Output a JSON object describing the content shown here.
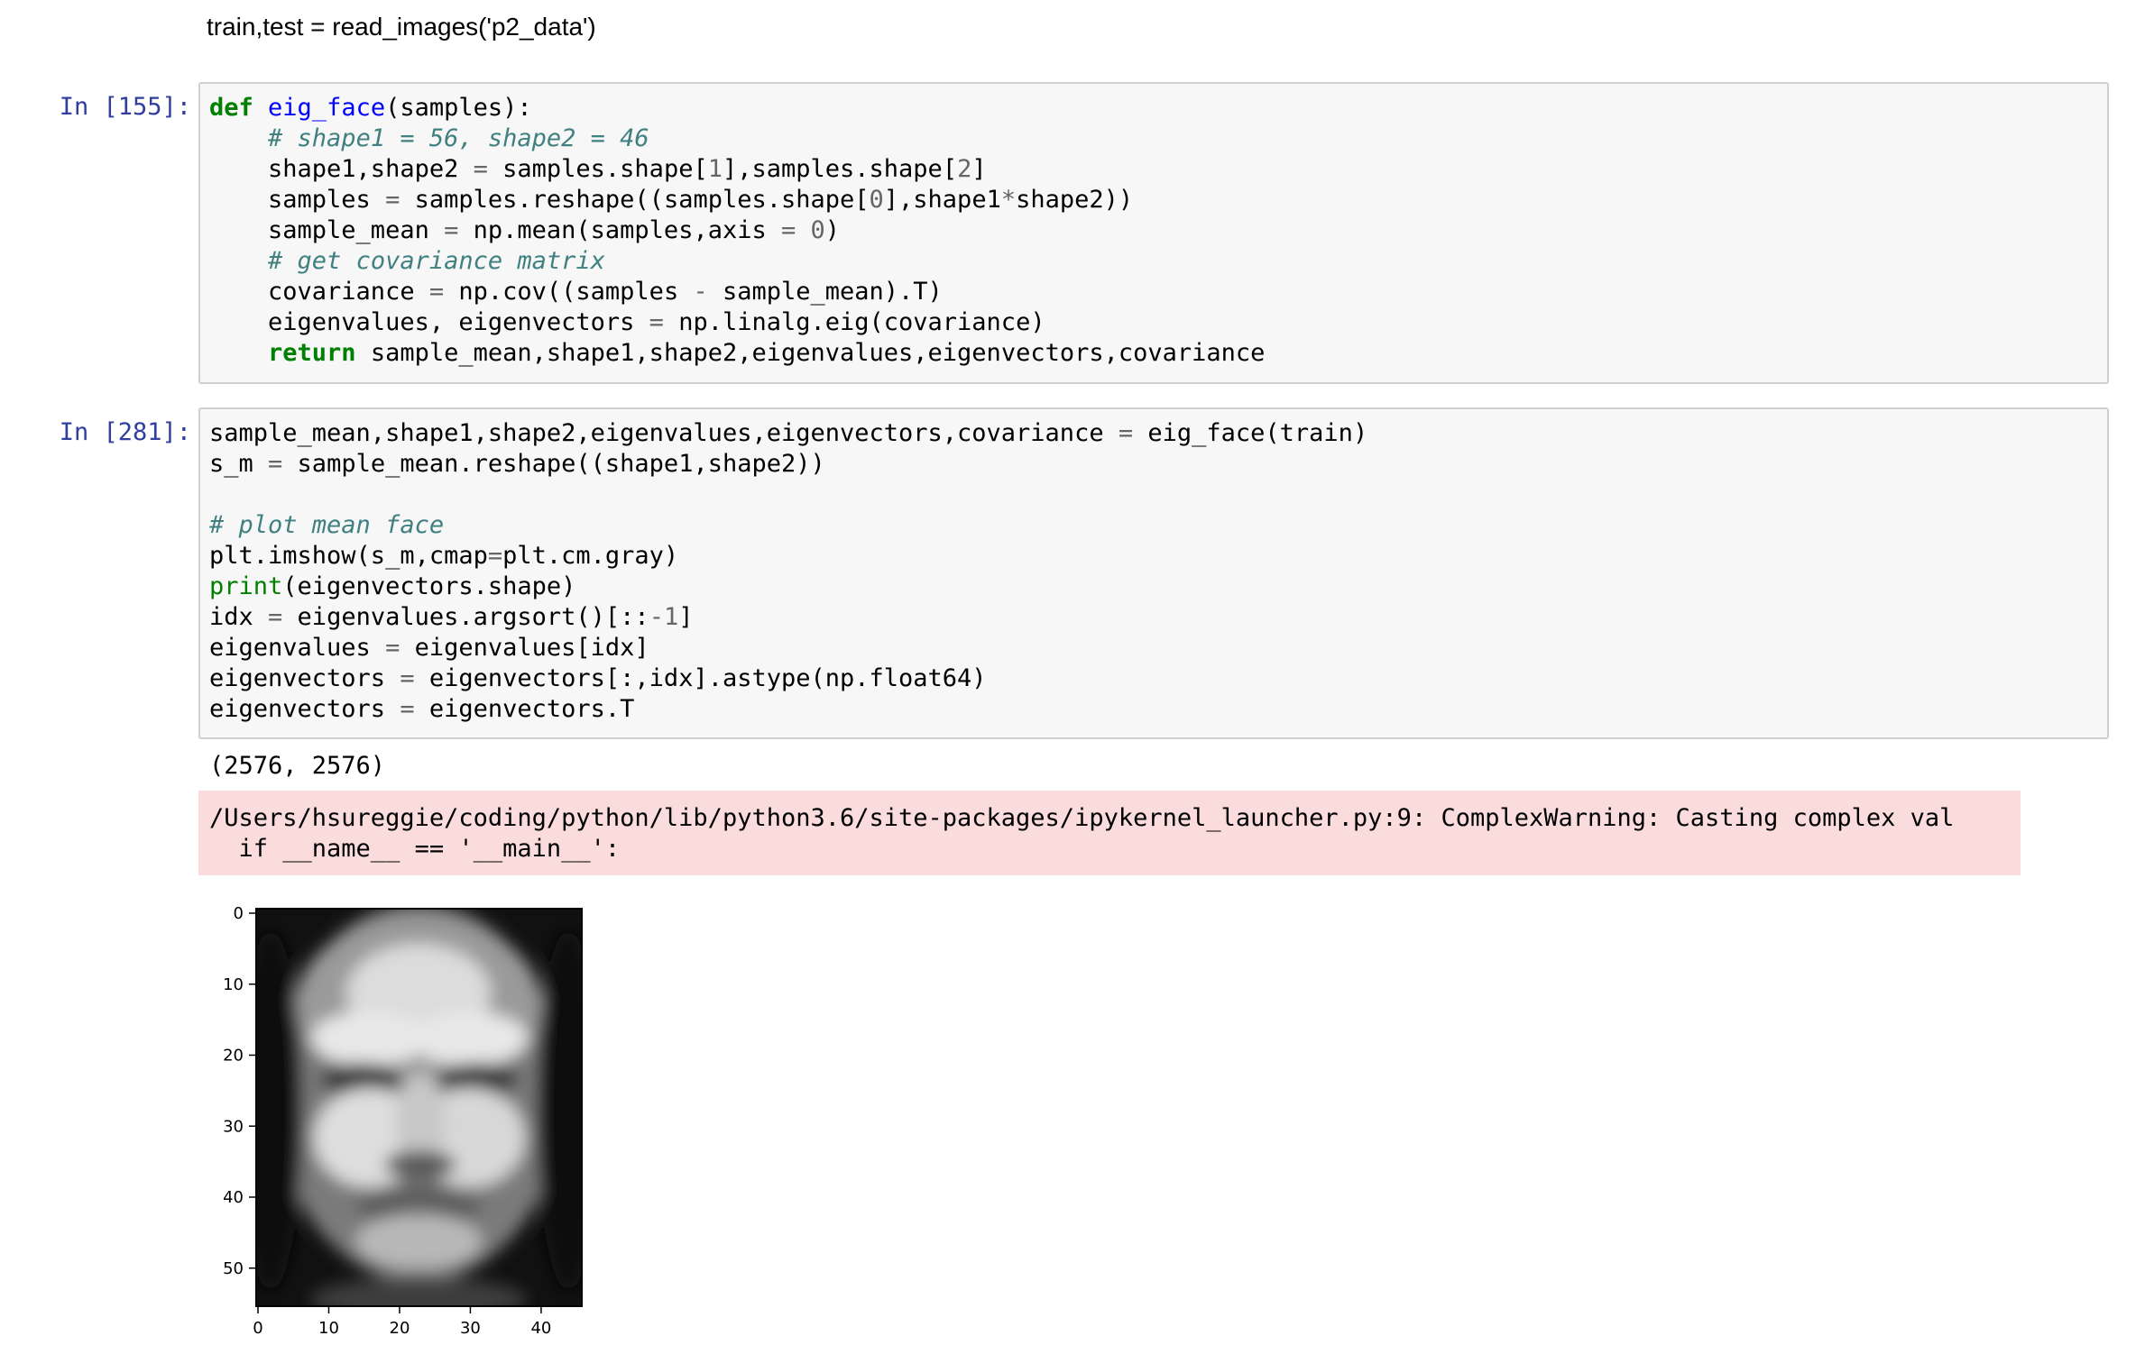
{
  "top_line": "train,test = read_images('p2_data')",
  "cells": [
    {
      "prompt": "In [155]:",
      "lines": [
        [
          [
            "kw",
            "def"
          ],
          [
            "t",
            " "
          ],
          [
            "fn",
            "eig_face"
          ],
          [
            "t",
            "(samples):"
          ]
        ],
        [
          [
            "t",
            "    "
          ],
          [
            "cm",
            "# shape1 = 56, shape2 = 46"
          ]
        ],
        [
          [
            "t",
            "    shape1,shape2 "
          ],
          [
            "op",
            "="
          ],
          [
            "t",
            " samples.shape["
          ],
          [
            "num",
            "1"
          ],
          [
            "t",
            "],samples.shape["
          ],
          [
            "num",
            "2"
          ],
          [
            "t",
            "]"
          ]
        ],
        [
          [
            "t",
            "    samples "
          ],
          [
            "op",
            "="
          ],
          [
            "t",
            " samples.reshape((samples.shape["
          ],
          [
            "num",
            "0"
          ],
          [
            "t",
            "],shape1"
          ],
          [
            "op",
            "*"
          ],
          [
            "t",
            "shape2))"
          ]
        ],
        [
          [
            "t",
            "    sample_mean "
          ],
          [
            "op",
            "="
          ],
          [
            "t",
            " np.mean(samples,axis "
          ],
          [
            "op",
            "="
          ],
          [
            "t",
            " "
          ],
          [
            "num",
            "0"
          ],
          [
            "t",
            ")"
          ]
        ],
        [
          [
            "t",
            "    "
          ],
          [
            "cm",
            "# get covariance matrix"
          ]
        ],
        [
          [
            "t",
            "    covariance "
          ],
          [
            "op",
            "="
          ],
          [
            "t",
            " np.cov((samples "
          ],
          [
            "op",
            "-"
          ],
          [
            "t",
            " sample_mean).T)"
          ]
        ],
        [
          [
            "t",
            "    eigenvalues, eigenvectors "
          ],
          [
            "op",
            "="
          ],
          [
            "t",
            " np.linalg.eig(covariance)"
          ]
        ],
        [
          [
            "t",
            "    "
          ],
          [
            "kw",
            "return"
          ],
          [
            "t",
            " sample_mean,shape1,shape2,eigenvalues,eigenvectors,covariance"
          ]
        ]
      ]
    },
    {
      "prompt": "In [281]:",
      "lines": [
        [
          [
            "t",
            "sample_mean,shape1,shape2,eigenvalues,eigenvectors,covariance "
          ],
          [
            "op",
            "="
          ],
          [
            "t",
            " eig_face(train)"
          ]
        ],
        [
          [
            "t",
            "s_m "
          ],
          [
            "op",
            "="
          ],
          [
            "t",
            " sample_mean.reshape((shape1,shape2))"
          ]
        ],
        [
          [
            "t",
            ""
          ]
        ],
        [
          [
            "cm",
            "# plot mean face"
          ]
        ],
        [
          [
            "t",
            "plt.imshow(s_m,cmap"
          ],
          [
            "op",
            "="
          ],
          [
            "t",
            "plt.cm.gray)"
          ]
        ],
        [
          [
            "bi",
            "print"
          ],
          [
            "t",
            "(eigenvectors.shape)"
          ]
        ],
        [
          [
            "t",
            "idx "
          ],
          [
            "op",
            "="
          ],
          [
            "t",
            " eigenvalues.argsort()[::"
          ],
          [
            "op",
            "-"
          ],
          [
            "num",
            "1"
          ],
          [
            "t",
            "]"
          ]
        ],
        [
          [
            "t",
            "eigenvalues "
          ],
          [
            "op",
            "="
          ],
          [
            "t",
            " eigenvalues[idx]"
          ]
        ],
        [
          [
            "t",
            "eigenvectors "
          ],
          [
            "op",
            "="
          ],
          [
            "t",
            " eigenvectors[:,idx].astype(np.float64)"
          ]
        ],
        [
          [
            "t",
            "eigenvectors "
          ],
          [
            "op",
            "="
          ],
          [
            "t",
            " eigenvectors.T"
          ]
        ]
      ]
    }
  ],
  "stdout": "(2576, 2576)",
  "stderr": [
    "/Users/hsureggie/coding/python/lib/python3.6/site-packages/ipykernel_launcher.py:9: ComplexWarning: Casting complex val",
    "  if __name__ == '__main__':"
  ],
  "plot": {
    "type": "image",
    "colormap": "gray",
    "xticks": [
      "0",
      "10",
      "20",
      "30",
      "40"
    ],
    "yticks": [
      "0",
      "10",
      "20",
      "30",
      "40",
      "50"
    ],
    "xlim": [
      0,
      46
    ],
    "ylim": [
      56,
      0
    ]
  }
}
